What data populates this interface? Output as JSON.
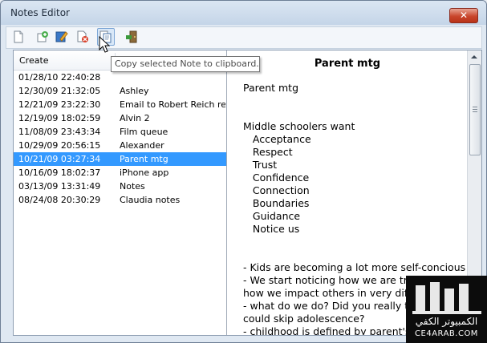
{
  "window": {
    "title": "Notes Editor",
    "close_glyph": "✕"
  },
  "toolbar": {
    "buttons": [
      {
        "name": "new-note-icon"
      },
      {
        "name": "add-note-icon"
      },
      {
        "name": "edit-note-icon"
      },
      {
        "name": "delete-note-icon"
      },
      {
        "name": "copy-note-icon"
      },
      {
        "name": "exit-icon"
      }
    ],
    "tooltip": "Copy selected Note to clipboard."
  },
  "list": {
    "header_create": "Create",
    "rows": [
      {
        "date": "01/28/10 22:40:28",
        "title": ""
      },
      {
        "date": "12/30/09 21:32:05",
        "title": "Ashley"
      },
      {
        "date": "12/21/09 23:22:30",
        "title": "Email to Robert Reich re biz"
      },
      {
        "date": "12/19/09 18:02:59",
        "title": "Alvin 2"
      },
      {
        "date": "11/08/09 23:43:34",
        "title": "Film queue"
      },
      {
        "date": "10/29/09 20:56:15",
        "title": "Alexander"
      },
      {
        "date": "10/21/09 03:27:34",
        "title": "Parent mtg",
        "selected": true
      },
      {
        "date": "10/16/09 18:02:37",
        "title": "iPhone app"
      },
      {
        "date": "03/13/09 13:31:49",
        "title": "Notes"
      },
      {
        "date": "08/24/08 20:30:29",
        "title": "Claudia notes"
      }
    ]
  },
  "note": {
    "heading": "Parent mtg",
    "body": "Parent mtg\n\n\nMiddle schoolers want\n   Acceptance\n   Respect\n   Trust\n   Confidence\n   Connection\n   Boundaries\n   Guidance\n   Notice us\n\n\n- Kids are becoming a lot more self-concious\n- We start noticing how we are treat\nhow we impact others in very differe\n- what do we do? Did you really thin\ncould skip adolescence?\n- childhood is defined by parent's wo"
  },
  "watermark": {
    "arabic": "الكمبيوتر الكفي",
    "site": "CE4ARAB.COM"
  },
  "colors": {
    "selection": "#3399ff",
    "close": "#c9462c"
  }
}
